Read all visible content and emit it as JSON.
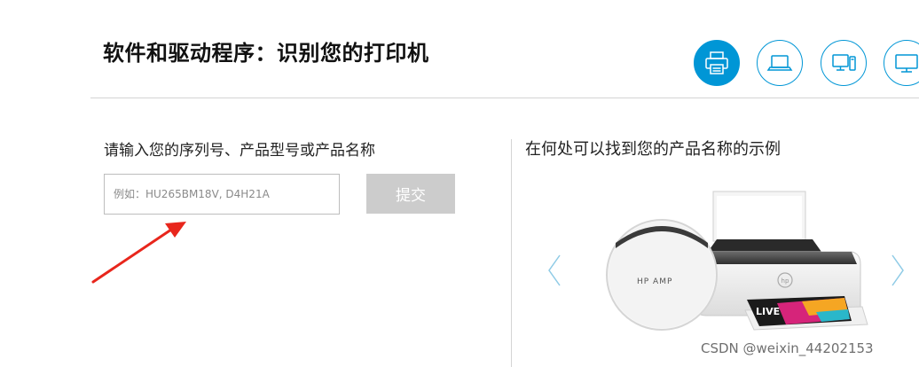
{
  "header": {
    "title": "软件和驱动程序：识别您的打印机",
    "device_buttons": [
      {
        "name": "printer",
        "icon": "printer-icon",
        "active": true
      },
      {
        "name": "laptop",
        "icon": "laptop-icon",
        "active": false
      },
      {
        "name": "desktop",
        "icon": "desktop-icon",
        "active": false
      },
      {
        "name": "monitor",
        "icon": "monitor-icon",
        "active": false
      }
    ]
  },
  "search": {
    "label": "请输入您的序列号、产品型号或产品名称",
    "placeholder": "例如：HU265BM18V, D4H21A",
    "submit_label": "提交"
  },
  "example": {
    "title": "在何处可以找到您的产品名称的示例",
    "magnifier_text": "HP AMP",
    "photo_text": "LIVE"
  },
  "annotation": {
    "arrow_color": "#e8261c"
  },
  "watermark": "CSDN @weixin_44202153",
  "colors": {
    "accent": "#0096d6",
    "submit_disabled": "#cccccc",
    "divider": "#d4d4d4"
  }
}
